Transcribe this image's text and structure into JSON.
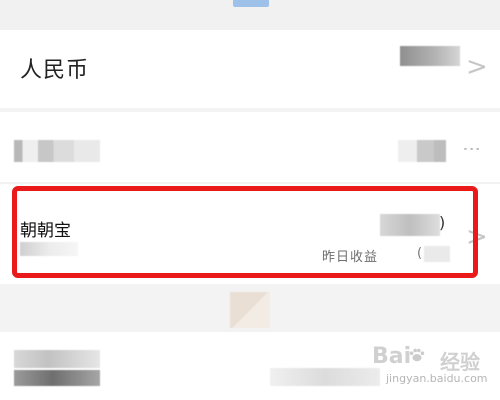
{
  "rows": {
    "currency": {
      "title": "人民币"
    },
    "zhaozhaobao": {
      "title": "朝朝宝",
      "yesterday_label": "昨日收益",
      "paren_close": ")",
      "paren_open": "("
    }
  },
  "icons": {
    "chevron": ">",
    "more": "⋮"
  },
  "watermark": {
    "brand": "Bai",
    "jingyan": "经验",
    "url": "jingyan.baidu.com"
  },
  "colors": {
    "highlight_border": "#ea1a1a",
    "top_tab": "#9ec1ea"
  }
}
